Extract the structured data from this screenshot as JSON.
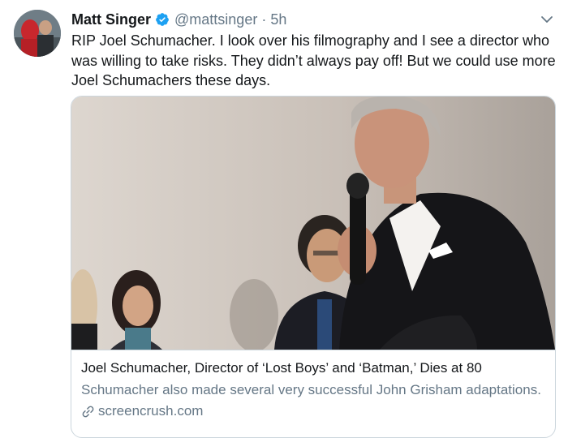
{
  "tweet": {
    "author_name": "Matt Singer",
    "handle": "@mattsinger",
    "separator": "·",
    "timestamp": "5h",
    "text": "RIP Joel Schumacher. I look over his filmography and I see a director who was willing to take risks. They didn’t always pay off! But we could use more Joel Schumachers these days."
  },
  "icons": {
    "verified": "verified-badge-icon",
    "menu": "chevron-down-icon",
    "link": "link-icon"
  },
  "card": {
    "title": "Joel Schumacher, Director of ‘Lost Boys’ and ‘Batman,’ Dies at 80",
    "description": "Schumacher also made several very successful John Grisham adaptations.",
    "domain": "screencrush.com"
  },
  "colors": {
    "verified_blue": "#1da1f2",
    "secondary_text": "#657786",
    "border": "#ccd6dd"
  }
}
